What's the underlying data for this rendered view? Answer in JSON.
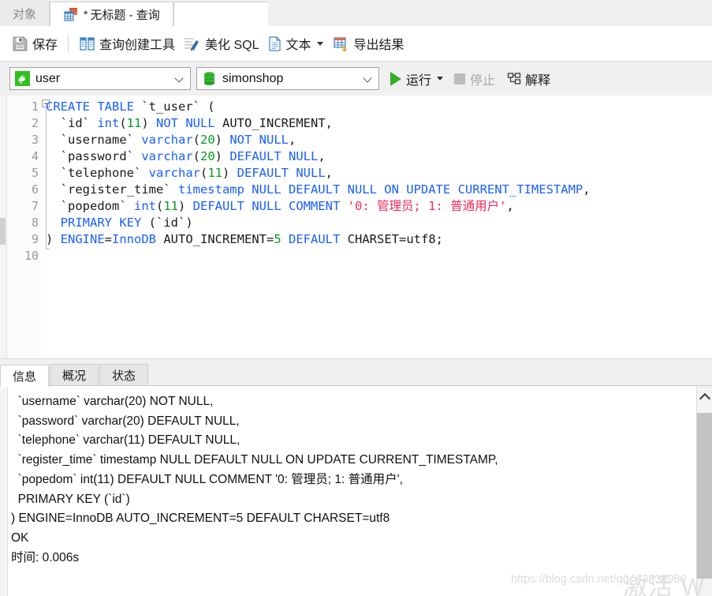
{
  "tabbar": {
    "object_tab": "对象",
    "query_tab_star": "*",
    "query_tab": "无标题 - 查询",
    "query_tab_icon": "query-grid-icon",
    "object_tab_icon": "object-tab-icon"
  },
  "toolbar": {
    "save": "保存",
    "save_icon": "save-floppy-icon",
    "query_builder": "查询创建工具",
    "query_builder_icon": "query-builder-icon",
    "beautify_sql": "美化 SQL",
    "beautify_icon": "beautify-pencil-icon",
    "text": "文本",
    "text_icon": "text-document-icon",
    "export_results": "导出结果",
    "export_icon": "export-table-icon"
  },
  "selectors": {
    "connection_value": "user",
    "connection_icon": "mysql-dolphin-icon",
    "database_value": "simonshop",
    "database_icon": "database-cylinder-icon",
    "run_label": "运行",
    "run_icon": "play-triangle-icon",
    "stop_label": "停止",
    "stop_icon": "stop-square-icon",
    "explain_label": "解释",
    "explain_icon": "explain-plan-icon"
  },
  "editor": {
    "line_numbers": [
      "1",
      "2",
      "3",
      "4",
      "5",
      "6",
      "7",
      "8",
      "9",
      "10"
    ],
    "lines": [
      [
        {
          "t": "CREATE TABLE",
          "c": "kw"
        },
        {
          "t": " `t_user` (",
          "c": "pln"
        }
      ],
      [
        {
          "t": "  `id` ",
          "c": "pln"
        },
        {
          "t": "int",
          "c": "kw"
        },
        {
          "t": "(",
          "c": "pln"
        },
        {
          "t": "11",
          "c": "num"
        },
        {
          "t": ") ",
          "c": "pln"
        },
        {
          "t": "NOT NULL",
          "c": "kw"
        },
        {
          "t": " AUTO_INCREMENT,",
          "c": "pln"
        }
      ],
      [
        {
          "t": "  `username` ",
          "c": "pln"
        },
        {
          "t": "varchar",
          "c": "kw"
        },
        {
          "t": "(",
          "c": "pln"
        },
        {
          "t": "20",
          "c": "num"
        },
        {
          "t": ") ",
          "c": "pln"
        },
        {
          "t": "NOT NULL",
          "c": "kw"
        },
        {
          "t": ",",
          "c": "pln"
        }
      ],
      [
        {
          "t": "  `password` ",
          "c": "pln"
        },
        {
          "t": "varchar",
          "c": "kw"
        },
        {
          "t": "(",
          "c": "pln"
        },
        {
          "t": "20",
          "c": "num"
        },
        {
          "t": ") ",
          "c": "pln"
        },
        {
          "t": "DEFAULT NULL",
          "c": "kw"
        },
        {
          "t": ",",
          "c": "pln"
        }
      ],
      [
        {
          "t": "  `telephone` ",
          "c": "pln"
        },
        {
          "t": "varchar",
          "c": "kw"
        },
        {
          "t": "(",
          "c": "pln"
        },
        {
          "t": "11",
          "c": "num"
        },
        {
          "t": ") ",
          "c": "pln"
        },
        {
          "t": "DEFAULT NULL",
          "c": "kw"
        },
        {
          "t": ",",
          "c": "pln"
        }
      ],
      [
        {
          "t": "  `register_time` ",
          "c": "pln"
        },
        {
          "t": "timestamp NULL DEFAULT NULL ON UPDATE CURRENT_TIMESTAMP",
          "c": "kw"
        },
        {
          "t": ",",
          "c": "pln"
        }
      ],
      [
        {
          "t": "  `popedom` ",
          "c": "pln"
        },
        {
          "t": "int",
          "c": "kw"
        },
        {
          "t": "(",
          "c": "pln"
        },
        {
          "t": "11",
          "c": "num"
        },
        {
          "t": ") ",
          "c": "pln"
        },
        {
          "t": "DEFAULT NULL COMMENT",
          "c": "kw"
        },
        {
          "t": " ",
          "c": "pln"
        },
        {
          "t": "'0: 管理员; 1: 普通用户'",
          "c": "str"
        },
        {
          "t": ",",
          "c": "pln"
        }
      ],
      [
        {
          "t": "  ",
          "c": "pln"
        },
        {
          "t": "PRIMARY KEY",
          "c": "kw"
        },
        {
          "t": " (`id`)",
          "c": "pln"
        }
      ],
      [
        {
          "t": ") ",
          "c": "pln"
        },
        {
          "t": "ENGINE",
          "c": "kw"
        },
        {
          "t": "=",
          "c": "pln"
        },
        {
          "t": "InnoDB",
          "c": "kw"
        },
        {
          "t": " AUTO_INCREMENT=",
          "c": "pln"
        },
        {
          "t": "5",
          "c": "num"
        },
        {
          "t": " ",
          "c": "pln"
        },
        {
          "t": "DEFAULT",
          "c": "kw"
        },
        {
          "t": " CHARSET=utf8;",
          "c": "pln"
        }
      ],
      []
    ]
  },
  "result_tabs": [
    {
      "label": "信息",
      "active": true
    },
    {
      "label": "概况",
      "active": false
    },
    {
      "label": "状态",
      "active": false
    }
  ],
  "output": {
    "text": "  `username` varchar(20) NOT NULL,\n  `password` varchar(20) DEFAULT NULL,\n  `telephone` varchar(11) DEFAULT NULL,\n  `register_time` timestamp NULL DEFAULT NULL ON UPDATE CURRENT_TIMESTAMP,\n  `popedom` int(11) DEFAULT NULL COMMENT '0: 管理员; 1: 普通用户',\n  PRIMARY KEY (`id`)\n) ENGINE=InnoDB AUTO_INCREMENT=5 DEFAULT CHARSET=utf8\nOK\n时间: 0.006s",
    "scrollbar_up_icon": "chevron-up-icon"
  },
  "watermarks": {
    "csdn": "https://blog.csdn.net/qq_43838980",
    "activate": "激活 W"
  },
  "colors": {
    "keyword": "#1a60ff",
    "number": "#0a9a23",
    "string": "#ef2b5d",
    "run_green": "#2fad28",
    "accent_blue": "#3d85c6"
  }
}
